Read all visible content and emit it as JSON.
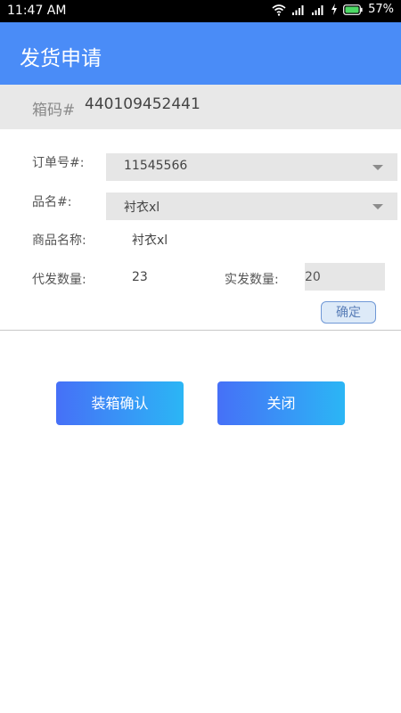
{
  "status_bar": {
    "time": "11:47 AM",
    "battery_percent": "57%",
    "icons": [
      "wifi-icon",
      "signal-icon",
      "signal-icon",
      "charging-icon",
      "battery-icon"
    ]
  },
  "header": {
    "title": "发货申请"
  },
  "box_code": {
    "label": "箱码#",
    "value": "440109452441"
  },
  "form": {
    "order_label": "订单号#:",
    "order_value": "11545566",
    "product_label": "品名#:",
    "product_value": "衬衣xl",
    "product_name_label": "商品名称:",
    "product_name_value": "衬衣xl",
    "pending_qty_label": "代发数量:",
    "pending_qty_value": "23",
    "actual_qty_label": "实发数量:",
    "actual_qty_value": "20",
    "confirm_label": "确定"
  },
  "actions": {
    "pack_confirm": "装箱确认",
    "close": "关闭"
  },
  "colors": {
    "app_bar": "#4a8cf7",
    "gradient_start": "#4670f7",
    "gradient_end": "#2bb6f5",
    "strip_bg": "#e8e8e8"
  }
}
